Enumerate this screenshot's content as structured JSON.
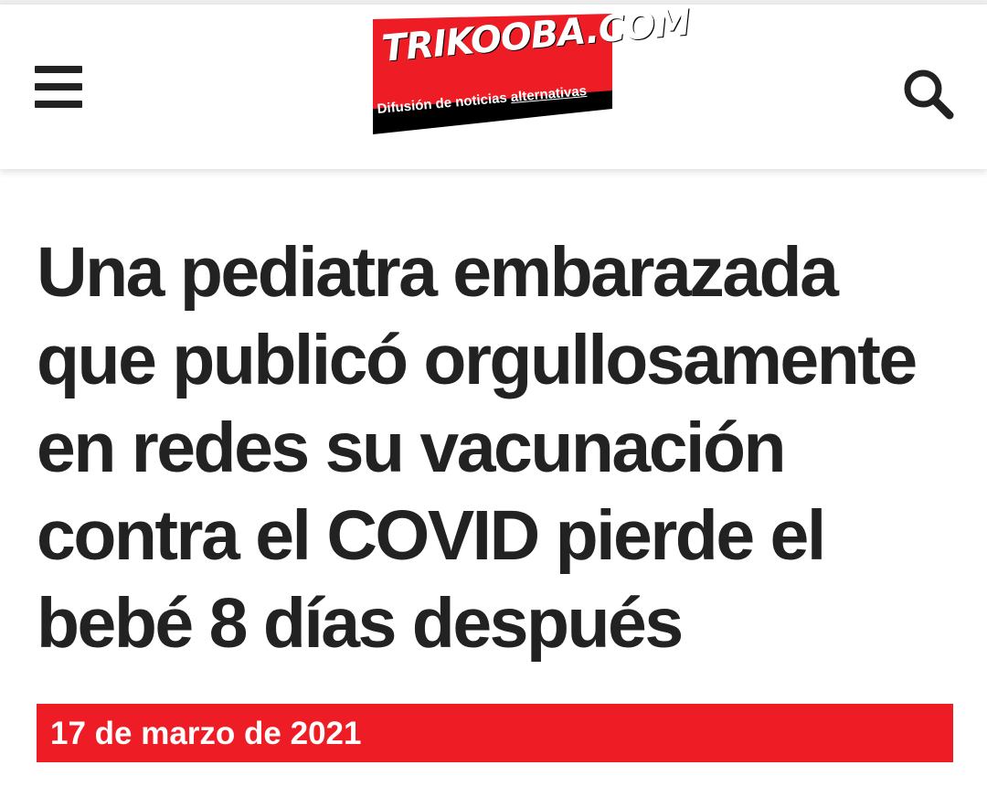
{
  "header": {
    "menu_icon": "hamburger-menu-icon",
    "search_icon": "search-icon",
    "logo": {
      "title": "TRIKOOBA.COM",
      "tagline_part1": "Difusión de noticias ",
      "tagline_part2": "alternativas",
      "brand_red": "#ee1c24",
      "brand_black": "#000000"
    }
  },
  "article": {
    "headline": "Una pediatra embarazada que publicó orgullosamente en redes su vacunación contra el COVID pierde el bebé 8 días después",
    "date": "17 de marzo de 2021"
  },
  "colors": {
    "accent": "#ee1c24",
    "text": "#222222",
    "background": "#ffffff"
  }
}
